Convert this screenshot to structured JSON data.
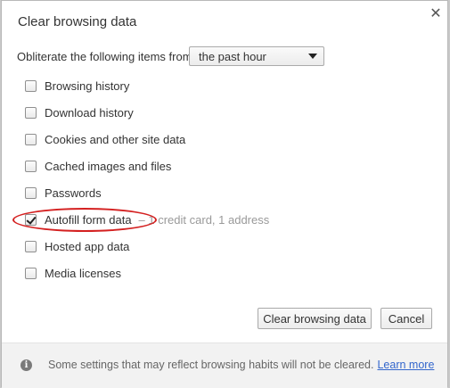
{
  "dialog": {
    "title": "Clear browsing data",
    "close_icon": "close-icon"
  },
  "range": {
    "label": "Obliterate the following items from:",
    "selected": "the past hour"
  },
  "items": [
    {
      "label": "Browsing history",
      "checked": false,
      "detail": ""
    },
    {
      "label": "Download history",
      "checked": false,
      "detail": ""
    },
    {
      "label": "Cookies and other site data",
      "checked": false,
      "detail": ""
    },
    {
      "label": "Cached images and files",
      "checked": false,
      "detail": ""
    },
    {
      "label": "Passwords",
      "checked": false,
      "detail": ""
    },
    {
      "label": "Autofill form data",
      "checked": true,
      "detail": "–  1 credit card, 1 address"
    },
    {
      "label": "Hosted app data",
      "checked": false,
      "detail": ""
    },
    {
      "label": "Media licenses",
      "checked": false,
      "detail": ""
    }
  ],
  "buttons": {
    "clear_label": "Clear browsing data",
    "cancel_label": "Cancel"
  },
  "footer": {
    "text": "Some settings that may reflect browsing habits will not be cleared.",
    "link": "Learn more",
    "icon": "info-icon"
  },
  "colors": {
    "annotation_oval": "#d42020",
    "link": "#3366cc"
  }
}
